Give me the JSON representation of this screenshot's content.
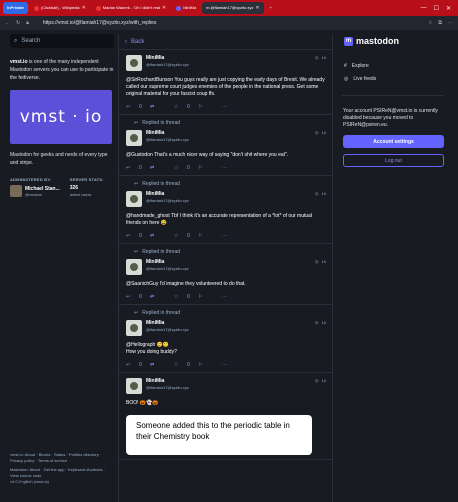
{
  "browser": {
    "profile_tab": "InPrivate",
    "tabs": [
      {
        "label": "(Clickbait) - Wikipedia",
        "color": "#e33"
      },
      {
        "label": "Marian Waurek - 'Oh I didn't real",
        "color": "#e33"
      },
      {
        "label": "MiniMa",
        "color": "#6364ff"
      },
      {
        "label": "m.@flamiah17@syzito.xyz",
        "color": "#6364ff"
      }
    ],
    "new_tab": "+",
    "url": "https://vmst.io/@flamiah17@syzito.xyz/with_replies"
  },
  "left": {
    "search_placeholder": "Search",
    "about_site": "vmst.io",
    "about_text": " is one of the many independent Mastodon servers you can use to participate in the fediverse.",
    "hero_text": "vmst · io",
    "tagline": "Mastodon for geeks and nerds of every type and stripe.",
    "admin_label": "ADMINISTERED BY:",
    "admin_name": "Michael Stan...",
    "admin_handle": "@vmstan",
    "stats_label": "SERVER STATS:",
    "stats_value": "326",
    "stats_sub": "active users",
    "footer_line1": "vmst.io: About · Blocks · Status · Profiles directory · Privacy policy · Terms of service",
    "footer_line2": "Mastodon: About · Get the app · Keyboard shortcuts · View source code",
    "footer_line3": "v4.0.2+glitch (vmst.io)"
  },
  "main": {
    "back_label": "Back",
    "replied_label": "Replied in thread",
    "posts": [
      {
        "name": "MiniMia",
        "acct": "@flamiah17@syzito.xyz",
        "time": "1h",
        "replied": false,
        "body": "@SirRochardBunson You guys really are just copying the early days of Brexit. We already called our supreme court judges enemies of the people in the national press. Get some original material for your fascist coup ffs.",
        "reply_count": "0",
        "fav_count": "0"
      },
      {
        "name": "MiniMia",
        "acct": "@flamiah17@syzito.xyz",
        "time": "1h",
        "replied": true,
        "body": "@Gustodon That's a much nicer way of saying \"don't shit where you eat\".",
        "reply_count": "0",
        "fav_count": "0"
      },
      {
        "name": "MiniMia",
        "acct": "@flamiah17@syzito.xyz",
        "time": "1h",
        "replied": true,
        "body": "@handmade_ghost Tbf I think it's an accurate representation of a *lot* of our mutual friends on here 😂",
        "reply_count": "0",
        "fav_count": "0"
      },
      {
        "name": "MiniMia",
        "acct": "@flamiah17@syzito.xyz",
        "time": "1h",
        "replied": true,
        "body": "@SaanichGuy I'd imagine they volunteered to do that.",
        "reply_count": "0",
        "fav_count": "0"
      },
      {
        "name": "MiniMia",
        "acct": "@flamiah17@syzito.xyz",
        "time": "1h",
        "replied": true,
        "body": "@Hellograph 😊🙂\nHow you doing buddy?",
        "reply_count": "0",
        "fav_count": "0"
      },
      {
        "name": "MiniMia",
        "acct": "@flamiah17@syzito.xyz",
        "time": "1h",
        "replied": false,
        "body": "BOO! 🎃👻🎃",
        "reply_count": "",
        "fav_count": ""
      }
    ],
    "media_text": "Someone added this to the periodic table in their Chemistry book"
  },
  "right": {
    "logo_text": "mastodon",
    "explore": "Explore",
    "live_feeds": "Live feeds",
    "disabled_text": "Your account PSIReN@vmst.io is currently disabled because you moved to PSIReN@psiren.eu.",
    "account_settings": "Account settings",
    "logout": "Log out"
  },
  "colors": {
    "accent": "#6364ff",
    "background": "#191b22",
    "browser_frame": "#b80f1b"
  }
}
